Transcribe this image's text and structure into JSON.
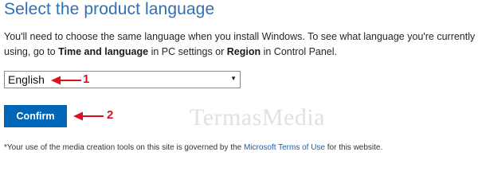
{
  "header": {
    "title": "Select the product language"
  },
  "description": {
    "part1": "You'll need to choose the same language when you install Windows. To see what language you're currently using, go to ",
    "bold1": "Time and language",
    "part2": " in PC settings or ",
    "bold2": "Region",
    "part3": " in Control Panel."
  },
  "language_select": {
    "selected": "English",
    "caret": "▼"
  },
  "confirm_button": {
    "label": "Confirm"
  },
  "annotations": {
    "marker1": "1",
    "marker2": "2",
    "arrow_color": "#e0101a"
  },
  "watermark": {
    "text": "TermasMedia"
  },
  "footer": {
    "prefix": "*Your use of the media creation tools on this site is governed by the ",
    "link": "Microsoft Terms of Use",
    "suffix": " for this website."
  },
  "colors": {
    "title": "#2f6fb7",
    "button_bg": "#0067b8",
    "link": "#1d5fae"
  }
}
